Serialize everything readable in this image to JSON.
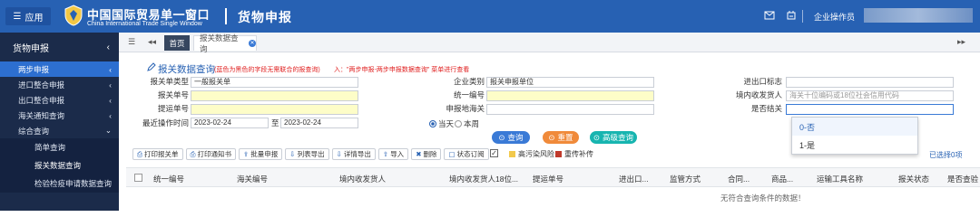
{
  "header": {
    "app_label": "应用",
    "brand_cn": "中国国际贸易单一窗口",
    "brand_en": "China International Trade Single Window",
    "page_title": "货物申报",
    "operator_label": "企业操作员"
  },
  "sidebar": {
    "title": "货物申报",
    "items": [
      {
        "label": "两步申报",
        "arrow": "‹"
      },
      {
        "label": "进口整合申报",
        "arrow": "‹"
      },
      {
        "label": "出口整合申报",
        "arrow": "‹"
      },
      {
        "label": "海关通知查询",
        "arrow": "‹"
      },
      {
        "label": "综合查询",
        "arrow": "⌄"
      }
    ],
    "subitems": [
      "简单查询",
      "报关数据查询",
      "检验检疫申请数据查询"
    ]
  },
  "tabs": {
    "home": "首页",
    "current": "报关数据查询"
  },
  "form": {
    "title": "报关数据查询",
    "note1": "(蓝色为黑色的字段无需联合的报查询)",
    "note2": "入：\"两步申报-两步申报数据查询\" 菜单进行查看",
    "labels": {
      "declare_type": "报关单类型",
      "declare_no": "报关单号",
      "bill_no": "提运单号",
      "op_time": "最近操作时间",
      "enterprise": "企业类别",
      "unified_no": "统一编号",
      "customs": "申报地海关",
      "ie_flag": "进出口标志",
      "consignee": "境内收发货人",
      "finished": "是否结关"
    },
    "values": {
      "declare_type": "一般报关单",
      "enterprise": "报关申报单位",
      "date_from": "2023-02-24",
      "date_to": "2023-02-24",
      "date_sep": "至",
      "consignee_placeholder": "海关十位编码或18位社会信用代码"
    },
    "radio_today": "当天",
    "radio_week": "本周",
    "btn_query": "查询",
    "btn_reset": "重置",
    "btn_advanced": "高级查询",
    "dropdown_options": [
      "0-否",
      "1-是"
    ]
  },
  "toolbar": {
    "buttons": [
      "打印报关单",
      "打印通知书",
      "批量申报",
      "列表导出",
      "详情导出",
      "导入",
      "删除",
      "状态订阅"
    ],
    "legend_risk": "高污染风险",
    "legend_resend": "重传补传",
    "selected": "已选择0项"
  },
  "table": {
    "columns": [
      "统一编号",
      "海关编号",
      "境内收发货人",
      "境内收发货人18位...",
      "提运单号",
      "进出口...",
      "监管方式",
      "合同...",
      "商品...",
      "运输工具名称",
      "报关状态",
      "是否查验"
    ],
    "empty_text": "无符合查询条件的数据！"
  },
  "colors": {
    "header_bg": "#2761b3",
    "sidebar_bg": "#1b2b4a",
    "active_item": "#2d6fd0",
    "btn_query": "#3a7ad6",
    "btn_reset": "#f08a3a",
    "btn_advanced": "#17b5b0",
    "required_bg": "#fdfdc8",
    "legend_risk": "#f2c94c",
    "legend_resend": "#c0392b"
  }
}
